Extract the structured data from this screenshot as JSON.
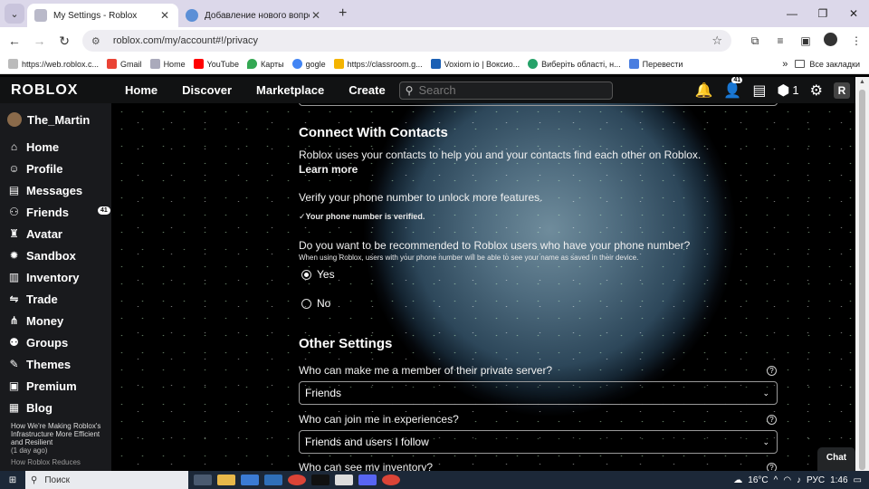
{
  "browser": {
    "tabs": [
      {
        "title": "My Settings - Roblox",
        "active": true
      },
      {
        "title": "Добавление нового вопроса",
        "active": false
      }
    ],
    "url": "roblox.com/my/account#!/privacy",
    "bookmarks": [
      "https://web.roblox.c...",
      "Gmail",
      "Home",
      "YouTube",
      "Карты",
      "gogle",
      "https://classroom.g...",
      "Voxiom io | Воксио...",
      "Виберіть області, н...",
      "Перевести"
    ],
    "all_bookmarks": "Все закладки"
  },
  "header": {
    "logo": "ROBLOX",
    "nav": [
      "Home",
      "Discover",
      "Marketplace",
      "Create"
    ],
    "search_placeholder": "Search",
    "notifications_badge": "41",
    "robux": "1"
  },
  "sidebar": {
    "username": "The_Martin",
    "items": [
      {
        "label": "Home",
        "icon": "home-icon"
      },
      {
        "label": "Profile",
        "icon": "profile-icon"
      },
      {
        "label": "Messages",
        "icon": "messages-icon"
      },
      {
        "label": "Friends",
        "icon": "friends-icon",
        "badge": "41"
      },
      {
        "label": "Avatar",
        "icon": "avatar-icon"
      },
      {
        "label": "Sandbox",
        "icon": "sandbox-icon"
      },
      {
        "label": "Inventory",
        "icon": "inventory-icon"
      },
      {
        "label": "Trade",
        "icon": "trade-icon"
      },
      {
        "label": "Money",
        "icon": "money-icon"
      },
      {
        "label": "Groups",
        "icon": "groups-icon"
      },
      {
        "label": "Themes",
        "icon": "themes-icon"
      },
      {
        "label": "Premium",
        "icon": "premium-icon"
      },
      {
        "label": "Blog",
        "icon": "blog-icon"
      }
    ],
    "blog_title": "How We're Making Roblox's Infrastructure More Efficient and Resilient",
    "blog_age": "(1 day ago)",
    "blog_next": "How Roblox Reduces"
  },
  "main": {
    "contacts_heading": "Connect With Contacts",
    "contacts_text": "Roblox uses your contacts to help you and your contacts find each other on Roblox.",
    "learn_more": "Learn more",
    "verify_text": "Verify your phone number to unlock more features.",
    "verified_text": "Your phone number is verified.",
    "recommend_question": "Do you want to be recommended to Roblox users who have your phone number?",
    "recommend_note": "When using Roblox, users with your phone number will be able to see your name as saved in their device.",
    "yes": "Yes",
    "no": "No",
    "other_heading": "Other Settings",
    "q1": "Who can make me a member of their private server?",
    "a1": "Friends",
    "q2": "Who can join me in experiences?",
    "a2": "Friends and users I follow",
    "q3": "Who can see my inventory?"
  },
  "chat_label": "Chat",
  "taskbar": {
    "search": "Поиск",
    "weather": "16°C",
    "lang": "РУС",
    "time": "1:46"
  }
}
